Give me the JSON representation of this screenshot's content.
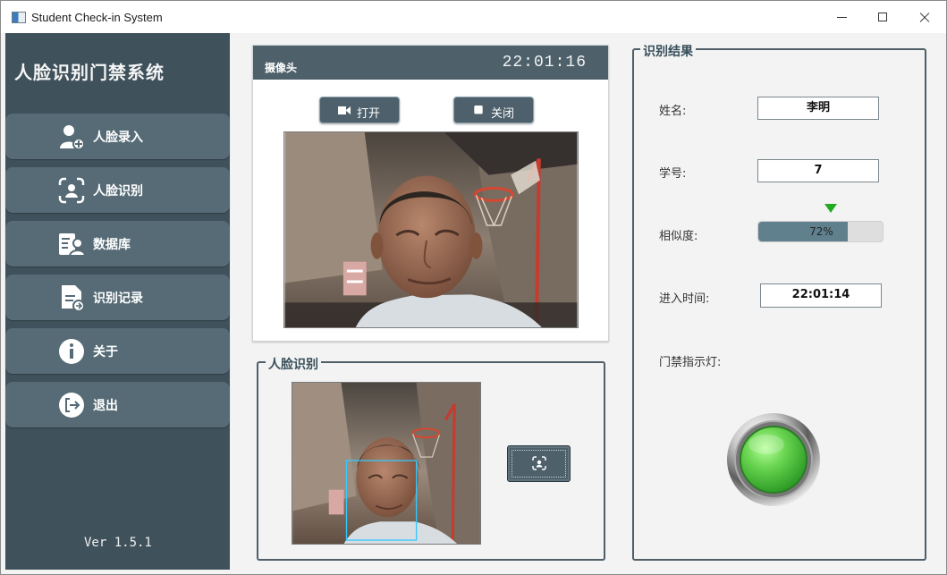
{
  "window": {
    "title": "Student Check-in System",
    "controls": [
      "minimize",
      "maximize",
      "close"
    ]
  },
  "sidebar": {
    "brand": "人脸识别门禁系统",
    "items": [
      {
        "label": "人脸录入",
        "icon": "user-add-icon"
      },
      {
        "label": "人脸识别",
        "icon": "face-scan-icon"
      },
      {
        "label": "数据库",
        "icon": "database-user-icon"
      },
      {
        "label": "识别记录",
        "icon": "record-icon"
      },
      {
        "label": "关于",
        "icon": "info-icon"
      },
      {
        "label": "退出",
        "icon": "logout-icon"
      }
    ],
    "version": "Ver 1.5.1"
  },
  "camera": {
    "title": "摄像头",
    "time": "22:01:16",
    "open_label": "打开",
    "close_label": "关闭"
  },
  "recognition": {
    "title": "人脸识别"
  },
  "result": {
    "title": "识别结果",
    "name_label": "姓名:",
    "name_value": "李明",
    "id_label": "学号:",
    "id_value": "7",
    "similarity_label": "相似度:",
    "similarity_value": "72%",
    "similarity_percent": 72,
    "time_label": "进入时间:",
    "time_value": "22:01:14",
    "lamp_label": "门禁指示灯:",
    "lamp_color": "#67d34f"
  },
  "colors": {
    "sidebar": "#3f515b",
    "menu": "#566b76",
    "accent_green": "#22aa22"
  }
}
